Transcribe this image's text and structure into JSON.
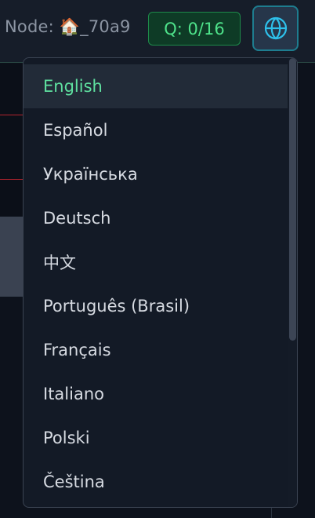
{
  "header": {
    "node_prefix": "Node: ",
    "node_emoji": "🏠",
    "node_id": "_70a9",
    "queue": "Q: 0/16",
    "language_button_icon": "globe-icon"
  },
  "language_menu": {
    "selected": "English",
    "items": [
      {
        "label": "English"
      },
      {
        "label": "Español"
      },
      {
        "label": "Українська"
      },
      {
        "label": "Deutsch"
      },
      {
        "label": "中文"
      },
      {
        "label": "Português (Brasil)"
      },
      {
        "label": "Français"
      },
      {
        "label": "Italiano"
      },
      {
        "label": "Polski"
      },
      {
        "label": "Čeština"
      }
    ]
  },
  "colors": {
    "accent_green": "#5fe0a0",
    "queue_green": "#4ee28a",
    "button_border": "#1e7d8f",
    "divider_red": "#b3232e"
  }
}
